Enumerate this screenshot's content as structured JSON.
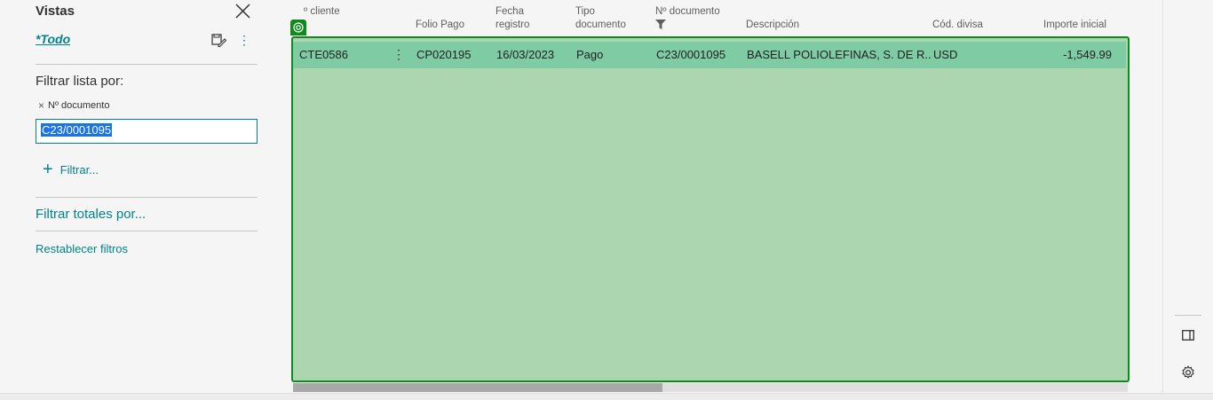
{
  "pane": {
    "title": "Vistas",
    "current_view": "*Todo",
    "filter_heading": "Filtrar lista por:",
    "filter_field": "Nº documento",
    "filter_value": "C23/0001095",
    "add_filter_label": "Filtrar...",
    "totals_label": "Filtrar totales por...",
    "reset_label": "Restablecer filtros"
  },
  "table": {
    "columns": [
      {
        "line1": "",
        "line2": "º cliente"
      },
      {
        "line1": "",
        "line2": "Folio Pago"
      },
      {
        "line1": "Fecha",
        "line2": "registro"
      },
      {
        "line1": "Tipo",
        "line2": "documento"
      },
      {
        "line1": "Nº documento",
        "line2": ""
      },
      {
        "line1": "",
        "line2": "Descripción"
      },
      {
        "line1": "",
        "line2": "Cód. divisa"
      },
      {
        "line1": "",
        "line2": "Importe inicial"
      }
    ],
    "rows": [
      {
        "customer": "CTE0586",
        "folio": "CP020195",
        "date": "16/03/2023",
        "doc_type": "Pago",
        "doc_no": "C23/0001095",
        "description": "BASELL POLIOLEFINAS, S. DE R....",
        "currency": "USD",
        "amount": "-1,549.99"
      }
    ]
  },
  "colors": {
    "accent": "#00838a",
    "selection_border": "#0e8c1b",
    "selection_fill": "#acd6b0",
    "row_fill": "#7fcca4"
  }
}
